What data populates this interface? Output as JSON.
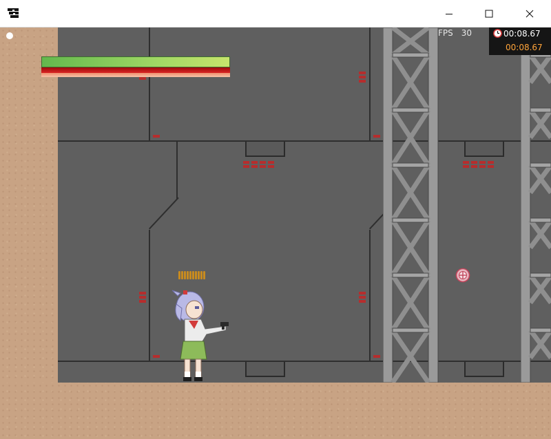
{
  "window": {
    "minimize_icon": "minimize-icon",
    "maximize_icon": "maximize-icon",
    "close_icon": "close-icon",
    "app_icon": "app-icon"
  },
  "hud": {
    "fps_label": "FPS",
    "fps_value": "30",
    "timer_total": "00:08.67",
    "timer_current": "00:08.67",
    "timer_icon": "clock-icon",
    "health_fraction": 1.0,
    "ammo_count": 10
  },
  "colors": {
    "health_green": "#8cc85a",
    "health_red": "#c81d1d",
    "timer_orange": "#ffa43a",
    "wall": "#5f5f5f",
    "dirt": "#c8a384"
  },
  "scene": {
    "player_icon": "player-character",
    "crosshair_icon": "crosshair-icon"
  }
}
